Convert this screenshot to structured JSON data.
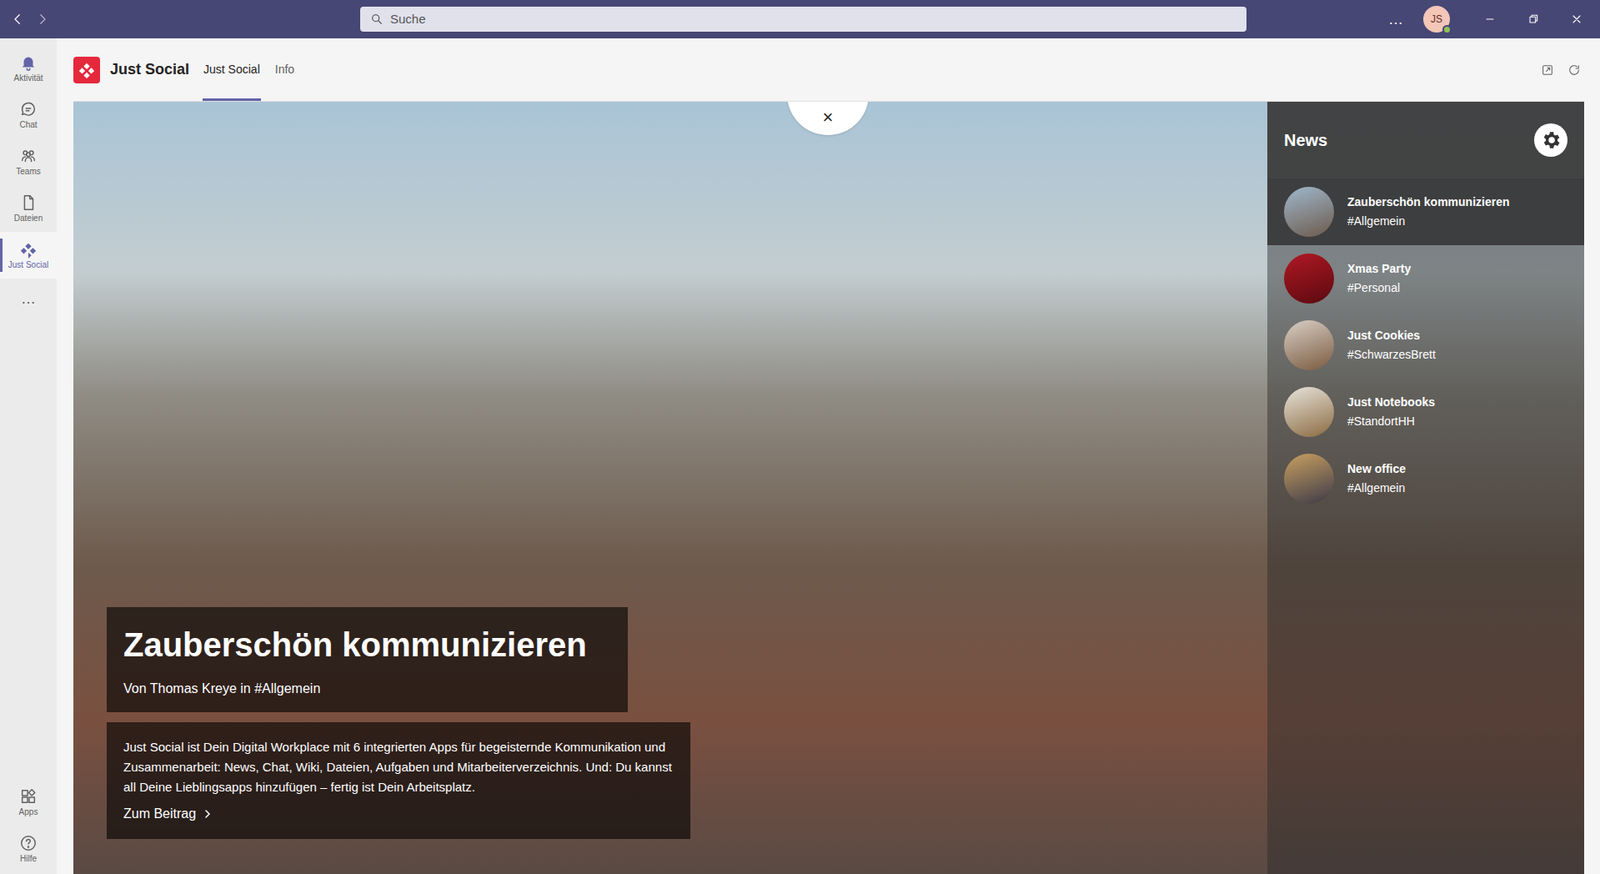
{
  "titlebar": {
    "search": {
      "placeholder": "Suche"
    },
    "more": "…",
    "avatar": "JS"
  },
  "rail": {
    "items": [
      {
        "label": "Aktivität",
        "selected": false
      },
      {
        "label": "Chat",
        "selected": false
      },
      {
        "label": "Teams",
        "selected": false
      },
      {
        "label": "Dateien",
        "selected": false
      },
      {
        "label": "Just Social",
        "selected": true
      }
    ],
    "more": "…",
    "bottom": [
      {
        "label": "Apps"
      },
      {
        "label": "Hilfe"
      }
    ]
  },
  "app": {
    "name": "Just Social",
    "tabs": [
      {
        "label": "Just Social",
        "selected": true
      },
      {
        "label": "Info",
        "selected": false
      }
    ]
  },
  "hero": {
    "close": "×",
    "title": "Zauberschön kommunizieren",
    "byline": "Von Thomas Kreye in #Allgemein",
    "description": "Just Social ist Dein Digital Workplace mit 6 integrierten Apps für begeisternde Kommunikation und Zusammenarbeit: News, Chat, Wiki, Dateien, Aufgaben und Mitarbeiterverzeichnis. Und: Du kannst all Deine Lieblingsapps hinzufügen – fertig ist Dein Arbeitsplatz.",
    "link": "Zum Beitrag"
  },
  "news": {
    "heading": "News",
    "items": [
      {
        "title": "Zauberschön kommunizieren",
        "tag": "#Allgemein",
        "selected": true
      },
      {
        "title": "Xmas Party",
        "tag": "#Personal",
        "selected": false
      },
      {
        "title": "Just Cookies",
        "tag": "#SchwarzesBrett",
        "selected": false
      },
      {
        "title": "Just Notebooks",
        "tag": "#StandortHH",
        "selected": false
      },
      {
        "title": "New office",
        "tag": "#Allgemein",
        "selected": false
      }
    ]
  }
}
